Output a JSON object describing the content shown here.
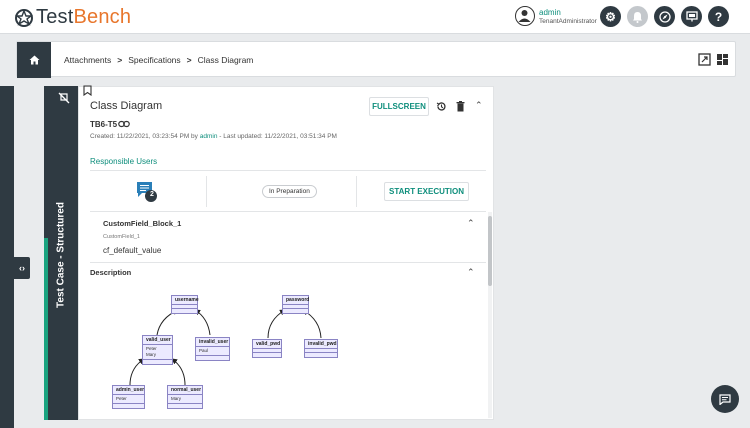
{
  "app": {
    "name_prefix": "Test",
    "name_suffix": "Bench"
  },
  "user": {
    "name": "admin",
    "role": "TenantAdministrator"
  },
  "breadcrumb": {
    "items": [
      "Attachments",
      "Specifications",
      "Class Diagram"
    ]
  },
  "side_tab": {
    "label": "Test Case - Structured"
  },
  "card": {
    "title": "Class Diagram",
    "fullscreen_label": "FULLSCREEN",
    "id": "TB6-T5",
    "meta_created_prefix": "Created: 11/22/2021, 03:23:54 PM by ",
    "meta_user": "admin",
    "meta_updated": " - Last updated: 11/22/2021, 03:51:34 PM",
    "responsible_users_label": "Responsible Users",
    "comment_count": "2",
    "status": "In Preparation",
    "start_label": "START EXECUTION",
    "custom_field": {
      "block_title": "CustomField_Block_1",
      "label": "CustomField_1",
      "value": "cf_default_value"
    },
    "description_label": "Description"
  },
  "diagram": {
    "username": "username",
    "password": "password",
    "valid_user": "valid_user",
    "valid_user_members": [
      "Peter",
      "Mary"
    ],
    "invalid_user": "invalid_user",
    "invalid_user_member": "Paul",
    "admin_user": "admin_user",
    "admin_user_member": "Peter",
    "normal_user": "normal_user",
    "normal_user_member": "Mary",
    "valid_pwd": "valid_pwd",
    "invalid_pwd": "invalid_pwd"
  },
  "colors": {
    "accent": "#0e8e7c",
    "dark": "#2f3a42",
    "orange": "#e8762c",
    "uml_fill": "#eceaff"
  }
}
